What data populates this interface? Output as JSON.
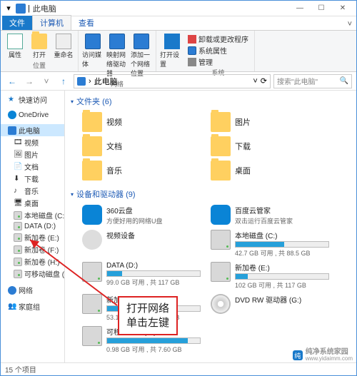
{
  "titlebar": {
    "title": "此电脑"
  },
  "winbuttons": {
    "min": "—",
    "max": "☐",
    "close": "✕"
  },
  "ribbon": {
    "tabs": {
      "file": "文件",
      "computer": "计算机",
      "view": "查看"
    },
    "collapse": "˅",
    "group1": {
      "btn_props": "属性",
      "btn_open": "打开",
      "btn_rename": "重命名",
      "label": "位置"
    },
    "group2": {
      "btn_access": "访问媒体",
      "btn_map": "映射网络驱动器",
      "btn_add": "添加一个网络位置",
      "label": "网络"
    },
    "group3": {
      "btn_settings": "打开设置",
      "li_uninstall": "卸载或更改程序",
      "li_sysprops": "系统属性",
      "li_manage": "管理",
      "label": "系统"
    }
  },
  "nav": {
    "back": "←",
    "fwd": "→",
    "up": "↑",
    "path_icon": "💻",
    "path": "此电脑",
    "path_sep": "›",
    "refresh": "⟳",
    "search_placeholder": "搜索\"此电脑\""
  },
  "sidebar": {
    "items": [
      {
        "label": "快速访问",
        "icon": "star"
      },
      {
        "label": "OneDrive",
        "icon": "cloud"
      },
      {
        "label": "此电脑",
        "icon": "pc",
        "selected": true
      },
      {
        "label": "视频",
        "icon": "folder",
        "sub": true
      },
      {
        "label": "图片",
        "icon": "folder",
        "sub": true
      },
      {
        "label": "文档",
        "icon": "folder",
        "sub": true
      },
      {
        "label": "下载",
        "icon": "folder",
        "sub": true
      },
      {
        "label": "音乐",
        "icon": "folder",
        "sub": true
      },
      {
        "label": "桌面",
        "icon": "folder",
        "sub": true
      },
      {
        "label": "本地磁盘 (C:)",
        "icon": "drive",
        "sub": true
      },
      {
        "label": "DATA (D:)",
        "icon": "drive",
        "sub": true
      },
      {
        "label": "新加卷 (E:)",
        "icon": "drive",
        "sub": true
      },
      {
        "label": "新加卷 (F:)",
        "icon": "drive",
        "sub": true
      },
      {
        "label": "新加卷 (H:)",
        "icon": "drive",
        "sub": true
      },
      {
        "label": "可移动磁盘 (H:)",
        "icon": "drive",
        "sub": true
      },
      {
        "label": "网络",
        "icon": "net"
      },
      {
        "label": "家庭组",
        "icon": "home"
      }
    ]
  },
  "content": {
    "folders_header": "文件夹 (6)",
    "folders": [
      {
        "label": "视频"
      },
      {
        "label": "图片"
      },
      {
        "label": "文档"
      },
      {
        "label": "下载"
      },
      {
        "label": "音乐"
      },
      {
        "label": "桌面"
      }
    ],
    "drives_header": "设备和驱动器 (9)",
    "apps": [
      {
        "name": "360云盘",
        "sub": "方便好用的网络U盘"
      },
      {
        "name": "百度云管家",
        "sub": "双击运行百度云管家"
      }
    ],
    "other": [
      {
        "name": "视频设备"
      }
    ],
    "drives": [
      {
        "name": "本地磁盘 (C:)",
        "stat": "42.7 GB 可用 , 共 88.5 GB",
        "pct": 52
      },
      {
        "name": "DATA (D:)",
        "stat": "99.0 GB 可用 , 共 117 GB",
        "pct": 16
      },
      {
        "name": "新加卷 (E:)",
        "stat": "102 GB 可用 , 共 117 GB",
        "pct": 13
      },
      {
        "name": "新加卷 (F:)",
        "stat": "53.1 GB 可用 , 共 117 GB",
        "pct": 55
      },
      {
        "name": "DVD RW 驱动器 (G:)",
        "stat": "",
        "pct": null,
        "dvd": true
      },
      {
        "name": "可移动磁盘 (H:)",
        "stat": "0.98 GB 可用 , 共 7.60 GB",
        "pct": 87
      }
    ]
  },
  "annotation": {
    "line1": "打开网络",
    "line2": "单击左键"
  },
  "statusbar": {
    "text": "15 个项目"
  },
  "watermark": {
    "brand": "纯净系统家园",
    "url": "www.yidaimm.com"
  }
}
